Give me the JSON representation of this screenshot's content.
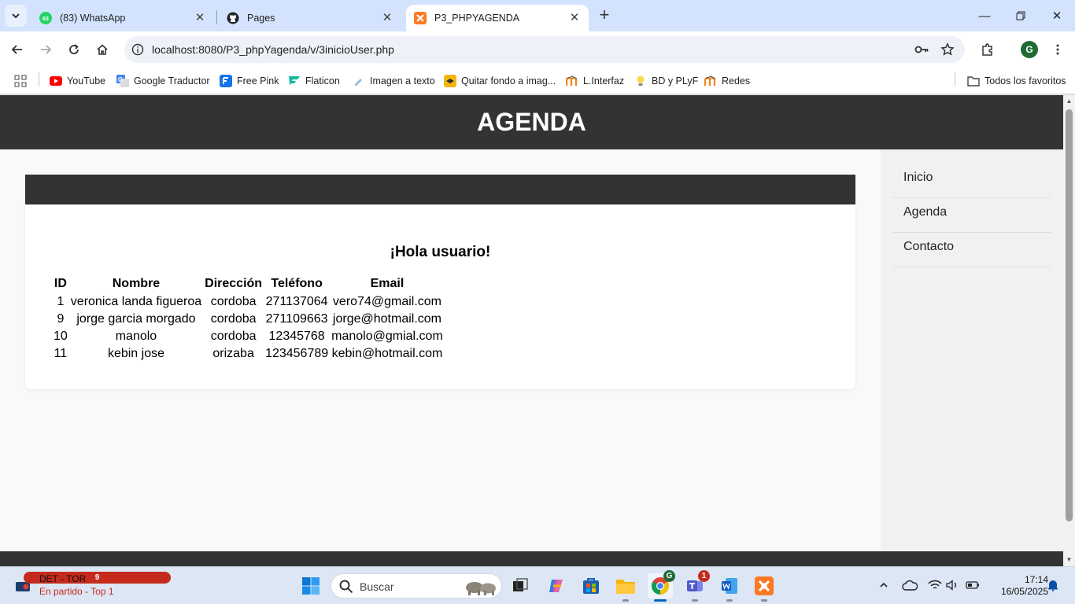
{
  "browser": {
    "tabs": [
      {
        "title": "(83) WhatsApp",
        "badge": "83"
      },
      {
        "title": "Pages"
      },
      {
        "title": "P3_PHPYAGENDA",
        "active": true
      }
    ],
    "url": "localhost:8080/P3_phpYagenda/v/3inicioUser.php",
    "profile_initial": "G",
    "bookmarks": [
      "YouTube",
      "Google Traductor",
      "Free Pink",
      "Flaticon",
      "Imagen a texto",
      "Quitar fondo a imag...",
      "L.Interfaz",
      "BD y PLyF",
      "Redes"
    ],
    "all_bookmarks": "Todos los favoritos"
  },
  "page": {
    "title": "AGENDA",
    "greeting": "¡Hola usuario!",
    "table": {
      "headers": [
        "ID",
        "Nombre",
        "Dirección",
        "Teléfono",
        "Email"
      ],
      "rows": [
        [
          "1",
          "veronica landa figueroa",
          "cordoba",
          "271137064",
          "vero74@gmail.com"
        ],
        [
          "9",
          "jorge garcia morgado",
          "cordoba",
          "271109663",
          "jorge@hotmail.com"
        ],
        [
          "10",
          "manolo",
          "cordoba",
          "12345768",
          "manolo@gmial.com"
        ],
        [
          "11",
          "kebin jose",
          "orizaba",
          "123456789",
          "kebin@hotmail.com"
        ]
      ]
    },
    "sidebar": [
      "Inicio",
      "Agenda",
      "Contacto"
    ],
    "colors": {
      "header": "#333333",
      "background": "#f9f9f9",
      "sidebar": "#f1f1f1"
    }
  },
  "taskbar": {
    "weather_badge": "9",
    "weather_title": "DET - TOR",
    "weather_sub": "En partido - Top 1",
    "search_placeholder": "Buscar",
    "teams_badge": "1",
    "chrome_badge": "G",
    "time": "17:14",
    "date": "16/05/2025"
  }
}
